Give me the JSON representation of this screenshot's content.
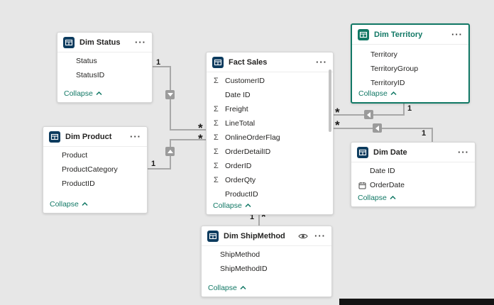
{
  "colors": {
    "accent": "#117865",
    "canvas_bg": "#e7e7e7",
    "table_icon_bg": "#0c3b5e",
    "relationship_line": "#a8a8a8"
  },
  "glyphs": {
    "more": "···",
    "sigma": "Σ"
  },
  "tables": [
    {
      "title": "Dim Status",
      "collapse_label": "Collapse",
      "fields": [
        {
          "name": "Status"
        },
        {
          "name": "StatusID"
        }
      ]
    },
    {
      "title": "Dim Product",
      "collapse_label": "Collapse",
      "fields": [
        {
          "name": "Product"
        },
        {
          "name": "ProductCategory"
        },
        {
          "name": "ProductID"
        }
      ]
    },
    {
      "title": "Fact Sales",
      "collapse_label": "Collapse",
      "fields": [
        {
          "name": "CustomerID",
          "icon": "sigma"
        },
        {
          "name": "Date ID"
        },
        {
          "name": "Freight",
          "icon": "sigma"
        },
        {
          "name": "LineTotal",
          "icon": "sigma"
        },
        {
          "name": "OnlineOrderFlag",
          "icon": "sigma"
        },
        {
          "name": "OrderDetailID",
          "icon": "sigma"
        },
        {
          "name": "OrderID",
          "icon": "sigma"
        },
        {
          "name": "OrderQty",
          "icon": "sigma"
        },
        {
          "name": "ProductID"
        }
      ]
    },
    {
      "title": "Dim Territory",
      "selected": true,
      "collapse_label": "Collapse",
      "fields": [
        {
          "name": "Territory"
        },
        {
          "name": "TerritoryGroup"
        },
        {
          "name": "TerritoryID"
        }
      ]
    },
    {
      "title": "Dim Date",
      "collapse_label": "Collapse",
      "fields": [
        {
          "name": "Date ID"
        },
        {
          "name": "OrderDate",
          "icon": "calendar"
        }
      ]
    },
    {
      "title": "Dim ShipMethod",
      "collapse_label": "Collapse",
      "fields": [
        {
          "name": "ShipMethod"
        },
        {
          "name": "ShipMethodID"
        }
      ]
    }
  ],
  "relationships": [
    {
      "from": "Dim Status",
      "to": "Fact Sales",
      "one": "1",
      "many": "*"
    },
    {
      "from": "Dim Product",
      "to": "Fact Sales",
      "one": "1",
      "many": "*"
    },
    {
      "from": "Dim Territory",
      "to": "Fact Sales",
      "one": "1",
      "many": "*"
    },
    {
      "from": "Dim Date",
      "to": "Fact Sales",
      "one": "1",
      "many": "*"
    },
    {
      "from": "Dim ShipMethod",
      "to": "Fact Sales",
      "one": "1",
      "many": "*"
    }
  ]
}
